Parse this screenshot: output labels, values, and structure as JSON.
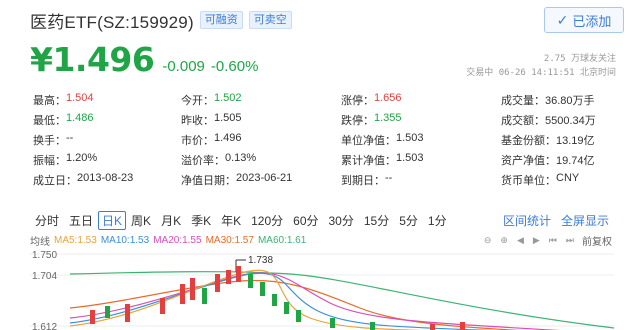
{
  "header": {
    "title": "医药ETF(SZ:159929)",
    "tags": [
      "可融资",
      "可卖空"
    ],
    "follow_label": "已添加"
  },
  "quote": {
    "price": "¥1.496",
    "change": "-0.009",
    "change_pct": "-0.60%",
    "followers": "2.75 万球友关注",
    "time_info": "交易中 06-26 14:11:51 北京时间"
  },
  "stats": [
    [
      {
        "label": "最高：",
        "value": "1.504",
        "color": "red"
      },
      {
        "label": "今开：",
        "value": "1.502",
        "color": "green"
      },
      {
        "label": "涨停：",
        "value": "1.656",
        "color": "red"
      },
      {
        "label": "成交量：",
        "value": "36.80万手",
        "color": "default"
      }
    ],
    [
      {
        "label": "最低：",
        "value": "1.486",
        "color": "green"
      },
      {
        "label": "昨收：",
        "value": "1.505",
        "color": "default"
      },
      {
        "label": "跌停：",
        "value": "1.355",
        "color": "green"
      },
      {
        "label": "成交额：",
        "value": "5500.34万",
        "color": "default"
      }
    ],
    [
      {
        "label": "换手：",
        "value": "--",
        "color": "default"
      },
      {
        "label": "市价：",
        "value": "1.496",
        "color": "default"
      },
      {
        "label": "单位净值：",
        "value": "1.503",
        "color": "default"
      },
      {
        "label": "基金份额：",
        "value": "13.19亿",
        "color": "default"
      }
    ],
    [
      {
        "label": "振幅：",
        "value": "1.20%",
        "color": "default"
      },
      {
        "label": "溢价率：",
        "value": "0.13%",
        "color": "default"
      },
      {
        "label": "累计净值：",
        "value": "1.503",
        "color": "default"
      },
      {
        "label": "资产净值：",
        "value": "19.74亿",
        "color": "default"
      }
    ],
    [
      {
        "label": "成立日：",
        "value": "2013-08-23",
        "color": "default"
      },
      {
        "label": "净值日期：",
        "value": "2023-06-21",
        "color": "default"
      },
      {
        "label": "到期日：",
        "value": "--",
        "color": "default"
      },
      {
        "label": "货币单位：",
        "value": "CNY",
        "color": "default"
      }
    ]
  ],
  "tabs": {
    "items": [
      "分时",
      "五日",
      "日K",
      "周K",
      "月K",
      "季K",
      "年K",
      "120分",
      "60分",
      "30分",
      "15分",
      "5分",
      "1分"
    ],
    "active": "日K",
    "links": [
      "区间统计",
      "全屏显示"
    ]
  },
  "ma": {
    "base_label": "均线",
    "items": [
      {
        "label": "MA5:1.53",
        "color": "#e8a33c"
      },
      {
        "label": "MA10:1.53",
        "color": "#3b8ed8"
      },
      {
        "label": "MA20:1.55",
        "color": "#d84fb4"
      },
      {
        "label": "MA30:1.57",
        "color": "#e86b2c"
      },
      {
        "label": "MA60:1.61",
        "color": "#3cb371"
      }
    ],
    "restore_label": "前复权"
  },
  "chart_labels": {
    "y_top": "1.750",
    "y_mid": "1.704",
    "y_bottom": "1.612",
    "peak": "1.738"
  },
  "colors": {
    "green": "#1fa546",
    "red": "#e33f3f",
    "blue": "#3d7cd6"
  }
}
